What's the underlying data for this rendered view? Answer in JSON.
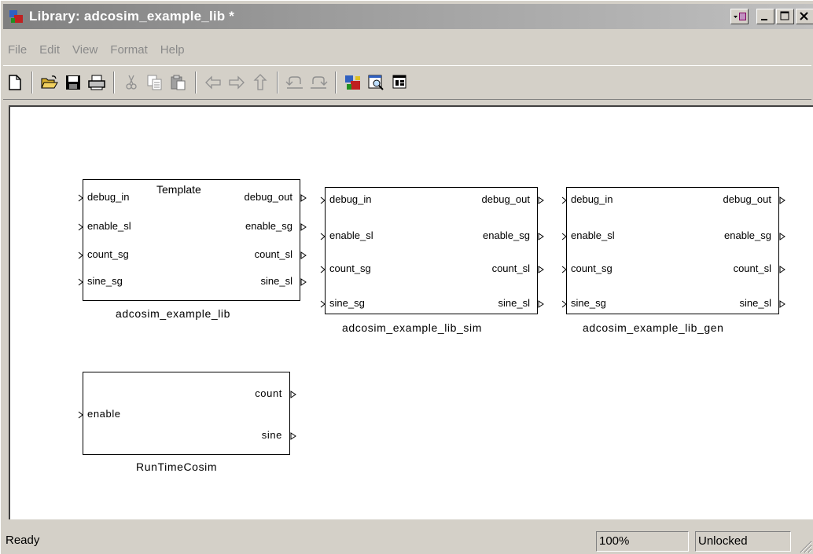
{
  "window": {
    "title": "Library: adcosim_example_lib *",
    "buttons": [
      "library-menu",
      "minimize",
      "maximize",
      "close"
    ]
  },
  "menu": [
    "File",
    "Edit",
    "View",
    "Format",
    "Help"
  ],
  "toolbar": {
    "tools": [
      "new-icon",
      "open-icon",
      "save-icon",
      "print-icon",
      "cut-icon",
      "copy-icon",
      "paste-icon",
      "back-icon",
      "forward-icon",
      "up-icon",
      "undo-icon",
      "redo-icon",
      "library-browser-icon",
      "model-explorer-icon",
      "debugger-icon"
    ]
  },
  "blocks": {
    "template": {
      "inner_title": "Template",
      "name": "adcosim_example_lib",
      "inputs": [
        "debug_in",
        "enable_sl",
        "count_sg",
        "sine_sg"
      ],
      "outputs": [
        "debug_out",
        "enable_sg",
        "count_sl",
        "sine_sl"
      ]
    },
    "sim": {
      "name": "adcosim_example_lib_sim",
      "inputs": [
        "debug_in",
        "enable_sl",
        "count_sg",
        "sine_sg"
      ],
      "outputs": [
        "debug_out",
        "enable_sg",
        "count_sl",
        "sine_sl"
      ]
    },
    "gen": {
      "name": "adcosim_example_lib_gen",
      "inputs": [
        "debug_in",
        "enable_sl",
        "count_sg",
        "sine_sg"
      ],
      "outputs": [
        "debug_out",
        "enable_sg",
        "count_sl",
        "sine_sl"
      ]
    },
    "runtime": {
      "name": "RunTimeCosim",
      "inputs": [
        "enable"
      ],
      "outputs": [
        "count",
        "sine"
      ]
    }
  },
  "status": {
    "text": "Ready",
    "zoom": "100%",
    "lock": "Unlocked"
  }
}
